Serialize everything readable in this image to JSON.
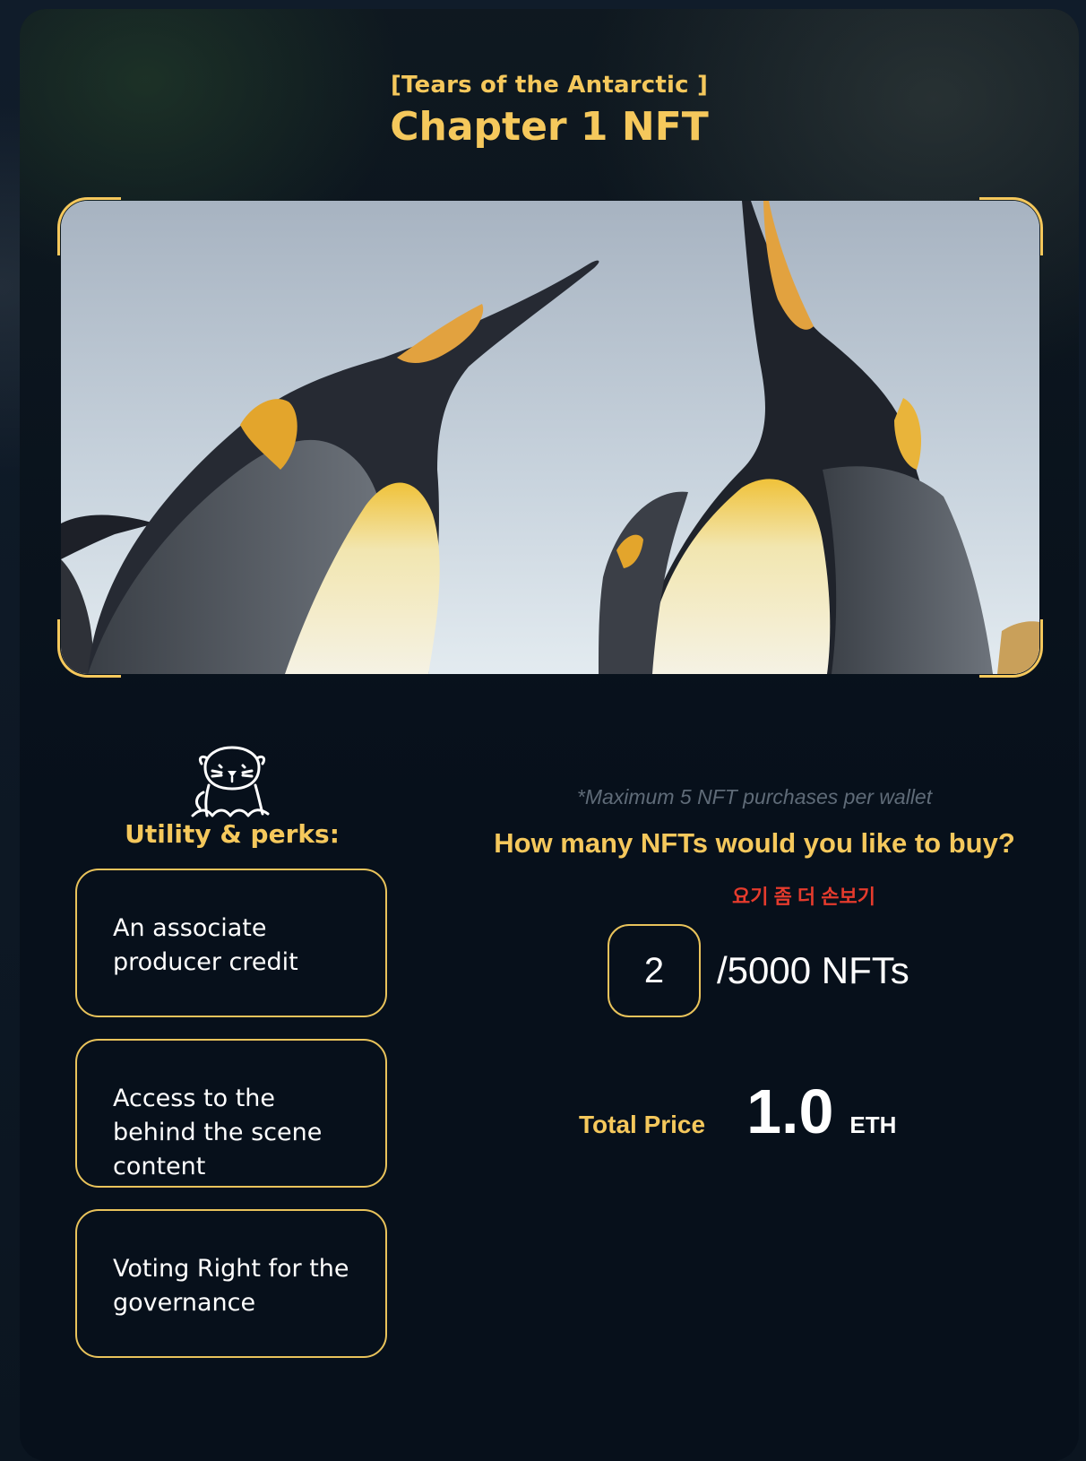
{
  "header": {
    "subtitle": "[Tears of the Antarctic ]",
    "title": "Chapter 1 NFT"
  },
  "hero": {
    "image_subject": "king-penguins-photo"
  },
  "perks": {
    "title": "Utility & perks:",
    "mascot_icon": "seal-mascot-icon",
    "items": [
      {
        "label": "An associate producer credit"
      },
      {
        "label": "Access to the behind the scene content"
      },
      {
        "label": "Voting Right for the governance"
      }
    ]
  },
  "purchase": {
    "limit_note": "*Maximum 5 NFT purchases per wallet",
    "question": "How many NFTs would you like to buy?",
    "review_note": "요기 좀 더 손보기",
    "quantity": "2",
    "supply_label": "/5000 NFTs",
    "total_label": "Total Price",
    "total_value": "1.0",
    "total_unit": "ETH"
  },
  "colors": {
    "accent": "#f5c85c",
    "background": "#07101b",
    "warning": "#e53b2d",
    "muted": "#5f6b78"
  }
}
